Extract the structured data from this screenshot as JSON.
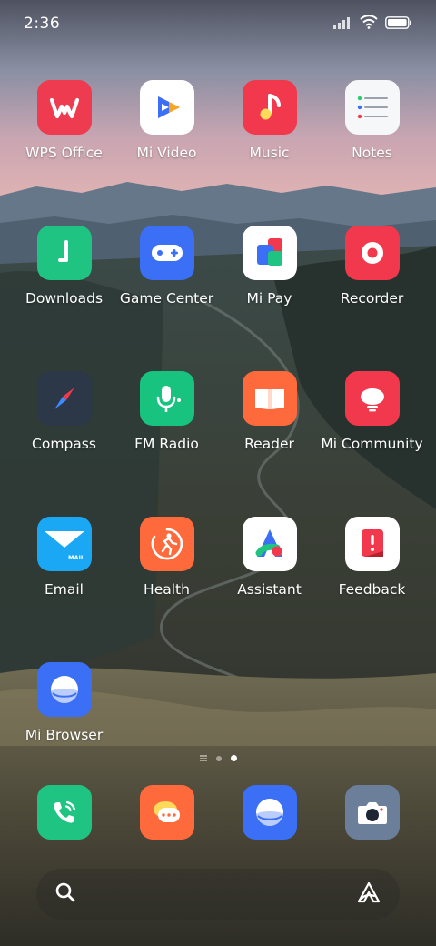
{
  "status_bar": {
    "time": "2:36",
    "icons": [
      "signal-icon",
      "wifi-icon",
      "battery-icon"
    ]
  },
  "apps": [
    {
      "label": "WPS Office",
      "icon": "wps-office-icon",
      "color": "#ef3b50"
    },
    {
      "label": "Mi Video",
      "icon": "mi-video-icon",
      "color": "#ffffff"
    },
    {
      "label": "Music",
      "icon": "music-icon",
      "color": "#f2384c"
    },
    {
      "label": "Notes",
      "icon": "notes-icon",
      "color": "#f6f7f9"
    },
    {
      "label": "Downloads",
      "icon": "downloads-icon",
      "color": "#1fc483"
    },
    {
      "label": "Game Center",
      "icon": "game-center-icon",
      "color": "#3a6ff6"
    },
    {
      "label": "Mi Pay",
      "icon": "mi-pay-icon",
      "color": "#ffffff"
    },
    {
      "label": "Recorder",
      "icon": "recorder-icon",
      "color": "#f2384c"
    },
    {
      "label": "Compass",
      "icon": "compass-icon",
      "color": "#2c3747"
    },
    {
      "label": "FM Radio",
      "icon": "fm-radio-icon",
      "color": "#18c27f"
    },
    {
      "label": "Reader",
      "icon": "reader-icon",
      "color": "#ff6a3d"
    },
    {
      "label": "Mi Community",
      "icon": "mi-community-icon",
      "color": "#f2384c"
    },
    {
      "label": "Email",
      "icon": "email-icon",
      "color": "#1aa8f5",
      "badge_text": "MAIL"
    },
    {
      "label": "Health",
      "icon": "health-icon",
      "color": "#ff6a3d"
    },
    {
      "label": "Assistant",
      "icon": "assistant-icon",
      "color": "#ffffff"
    },
    {
      "label": "Feedback",
      "icon": "feedback-icon",
      "color": "#ffffff"
    },
    {
      "label": "Mi Browser",
      "icon": "mi-browser-icon",
      "color": "#3a6ff6"
    }
  ],
  "page_indicator": {
    "pages": 2,
    "current": 2
  },
  "dock": [
    {
      "icon": "phone-icon",
      "color": "#1fc483"
    },
    {
      "icon": "messaging-icon",
      "color": "#ff6a3d"
    },
    {
      "icon": "browser-icon",
      "color": "#3a6ff6"
    },
    {
      "icon": "camera-icon",
      "color": "#6c7f9a"
    }
  ],
  "search_bar": {
    "left_icon": "search-icon",
    "right_icon": "assistant-icon"
  }
}
